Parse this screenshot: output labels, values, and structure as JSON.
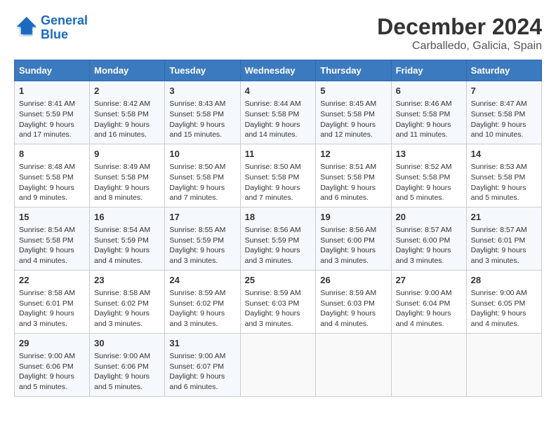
{
  "header": {
    "logo_line1": "General",
    "logo_line2": "Blue",
    "title": "December 2024",
    "subtitle": "Carballedo, Galicia, Spain"
  },
  "days_of_week": [
    "Sunday",
    "Monday",
    "Tuesday",
    "Wednesday",
    "Thursday",
    "Friday",
    "Saturday"
  ],
  "weeks": [
    [
      {
        "day": "1",
        "info": "Sunrise: 8:41 AM\nSunset: 5:59 PM\nDaylight: 9 hours and 17 minutes."
      },
      {
        "day": "2",
        "info": "Sunrise: 8:42 AM\nSunset: 5:58 PM\nDaylight: 9 hours and 16 minutes."
      },
      {
        "day": "3",
        "info": "Sunrise: 8:43 AM\nSunset: 5:58 PM\nDaylight: 9 hours and 15 minutes."
      },
      {
        "day": "4",
        "info": "Sunrise: 8:44 AM\nSunset: 5:58 PM\nDaylight: 9 hours and 14 minutes."
      },
      {
        "day": "5",
        "info": "Sunrise: 8:45 AM\nSunset: 5:58 PM\nDaylight: 9 hours and 12 minutes."
      },
      {
        "day": "6",
        "info": "Sunrise: 8:46 AM\nSunset: 5:58 PM\nDaylight: 9 hours and 11 minutes."
      },
      {
        "day": "7",
        "info": "Sunrise: 8:47 AM\nSunset: 5:58 PM\nDaylight: 9 hours and 10 minutes."
      }
    ],
    [
      {
        "day": "8",
        "info": "Sunrise: 8:48 AM\nSunset: 5:58 PM\nDaylight: 9 hours and 9 minutes."
      },
      {
        "day": "9",
        "info": "Sunrise: 8:49 AM\nSunset: 5:58 PM\nDaylight: 9 hours and 8 minutes."
      },
      {
        "day": "10",
        "info": "Sunrise: 8:50 AM\nSunset: 5:58 PM\nDaylight: 9 hours and 7 minutes."
      },
      {
        "day": "11",
        "info": "Sunrise: 8:50 AM\nSunset: 5:58 PM\nDaylight: 9 hours and 7 minutes."
      },
      {
        "day": "12",
        "info": "Sunrise: 8:51 AM\nSunset: 5:58 PM\nDaylight: 9 hours and 6 minutes."
      },
      {
        "day": "13",
        "info": "Sunrise: 8:52 AM\nSunset: 5:58 PM\nDaylight: 9 hours and 5 minutes."
      },
      {
        "day": "14",
        "info": "Sunrise: 8:53 AM\nSunset: 5:58 PM\nDaylight: 9 hours and 5 minutes."
      }
    ],
    [
      {
        "day": "15",
        "info": "Sunrise: 8:54 AM\nSunset: 5:58 PM\nDaylight: 9 hours and 4 minutes."
      },
      {
        "day": "16",
        "info": "Sunrise: 8:54 AM\nSunset: 5:59 PM\nDaylight: 9 hours and 4 minutes."
      },
      {
        "day": "17",
        "info": "Sunrise: 8:55 AM\nSunset: 5:59 PM\nDaylight: 9 hours and 3 minutes."
      },
      {
        "day": "18",
        "info": "Sunrise: 8:56 AM\nSunset: 5:59 PM\nDaylight: 9 hours and 3 minutes."
      },
      {
        "day": "19",
        "info": "Sunrise: 8:56 AM\nSunset: 6:00 PM\nDaylight: 9 hours and 3 minutes."
      },
      {
        "day": "20",
        "info": "Sunrise: 8:57 AM\nSunset: 6:00 PM\nDaylight: 9 hours and 3 minutes."
      },
      {
        "day": "21",
        "info": "Sunrise: 8:57 AM\nSunset: 6:01 PM\nDaylight: 9 hours and 3 minutes."
      }
    ],
    [
      {
        "day": "22",
        "info": "Sunrise: 8:58 AM\nSunset: 6:01 PM\nDaylight: 9 hours and 3 minutes."
      },
      {
        "day": "23",
        "info": "Sunrise: 8:58 AM\nSunset: 6:02 PM\nDaylight: 9 hours and 3 minutes."
      },
      {
        "day": "24",
        "info": "Sunrise: 8:59 AM\nSunset: 6:02 PM\nDaylight: 9 hours and 3 minutes."
      },
      {
        "day": "25",
        "info": "Sunrise: 8:59 AM\nSunset: 6:03 PM\nDaylight: 9 hours and 3 minutes."
      },
      {
        "day": "26",
        "info": "Sunrise: 8:59 AM\nSunset: 6:03 PM\nDaylight: 9 hours and 4 minutes."
      },
      {
        "day": "27",
        "info": "Sunrise: 9:00 AM\nSunset: 6:04 PM\nDaylight: 9 hours and 4 minutes."
      },
      {
        "day": "28",
        "info": "Sunrise: 9:00 AM\nSunset: 6:05 PM\nDaylight: 9 hours and 4 minutes."
      }
    ],
    [
      {
        "day": "29",
        "info": "Sunrise: 9:00 AM\nSunset: 6:06 PM\nDaylight: 9 hours and 5 minutes."
      },
      {
        "day": "30",
        "info": "Sunrise: 9:00 AM\nSunset: 6:06 PM\nDaylight: 9 hours and 5 minutes."
      },
      {
        "day": "31",
        "info": "Sunrise: 9:00 AM\nSunset: 6:07 PM\nDaylight: 9 hours and 6 minutes."
      },
      null,
      null,
      null,
      null
    ]
  ]
}
